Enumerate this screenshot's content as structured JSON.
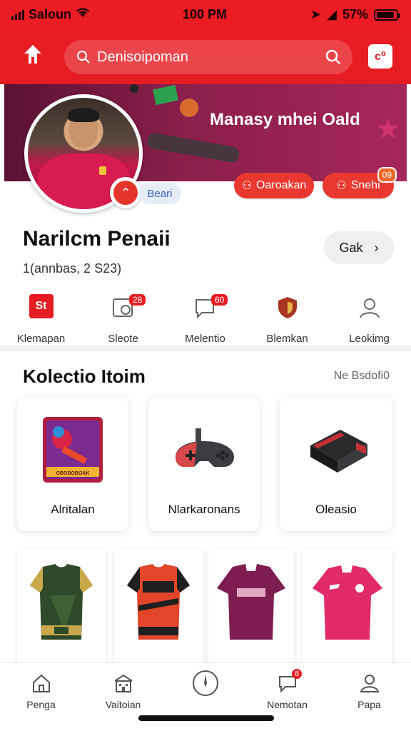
{
  "status": {
    "carrier": "Saloun",
    "time": "100 PM",
    "battery": "57%"
  },
  "colors": {
    "accent": "#e41d22",
    "banner": "#8a1f4a"
  },
  "header": {
    "logo_icon": "app-logo-icon",
    "search_text": "Denisoipoman",
    "search_icon": "search-icon",
    "msg_label": "c⁰"
  },
  "banner": {
    "title": "Manasy mhei Oald",
    "beam_label": "Beari",
    "actions": [
      {
        "label": "Oaroakan",
        "icon": "person-icon"
      },
      {
        "label": "Snehi",
        "icon": "person-icon",
        "badge": "09"
      }
    ]
  },
  "profile": {
    "name": "Narilcm Penaii",
    "subtitle": "1(annbas, 2 S23)",
    "action_label": "Gak"
  },
  "quick": [
    {
      "label": "Klemapan",
      "icon": "st-icon",
      "badge": ""
    },
    {
      "label": "Sleote",
      "icon": "clock-card-icon",
      "badge": "28"
    },
    {
      "label": "Melentio",
      "icon": "chat-icon",
      "badge": "60"
    },
    {
      "label": "Blemkan",
      "icon": "shield-icon",
      "badge": ""
    },
    {
      "label": "Leokimg",
      "icon": "user-icon",
      "badge": ""
    }
  ],
  "collection": {
    "title": "Kolectio Itoim",
    "link": "Ne Bsdofi0",
    "cards": [
      {
        "label": "Alritalan"
      },
      {
        "label": "Nlarkaronans"
      },
      {
        "label": "Oleasio"
      }
    ],
    "card1_caption": "OBOBOBOAK"
  },
  "nav": [
    {
      "label": "Penga",
      "icon": "home-icon",
      "badge": ""
    },
    {
      "label": "Vaitoian",
      "icon": "building-icon",
      "badge": ""
    },
    {
      "label": "",
      "icon": "compass-icon",
      "badge": ""
    },
    {
      "label": "Nemotan",
      "icon": "chat-bubble-icon",
      "badge": "8"
    },
    {
      "label": "Papa",
      "icon": "profile-icon",
      "badge": ""
    }
  ]
}
